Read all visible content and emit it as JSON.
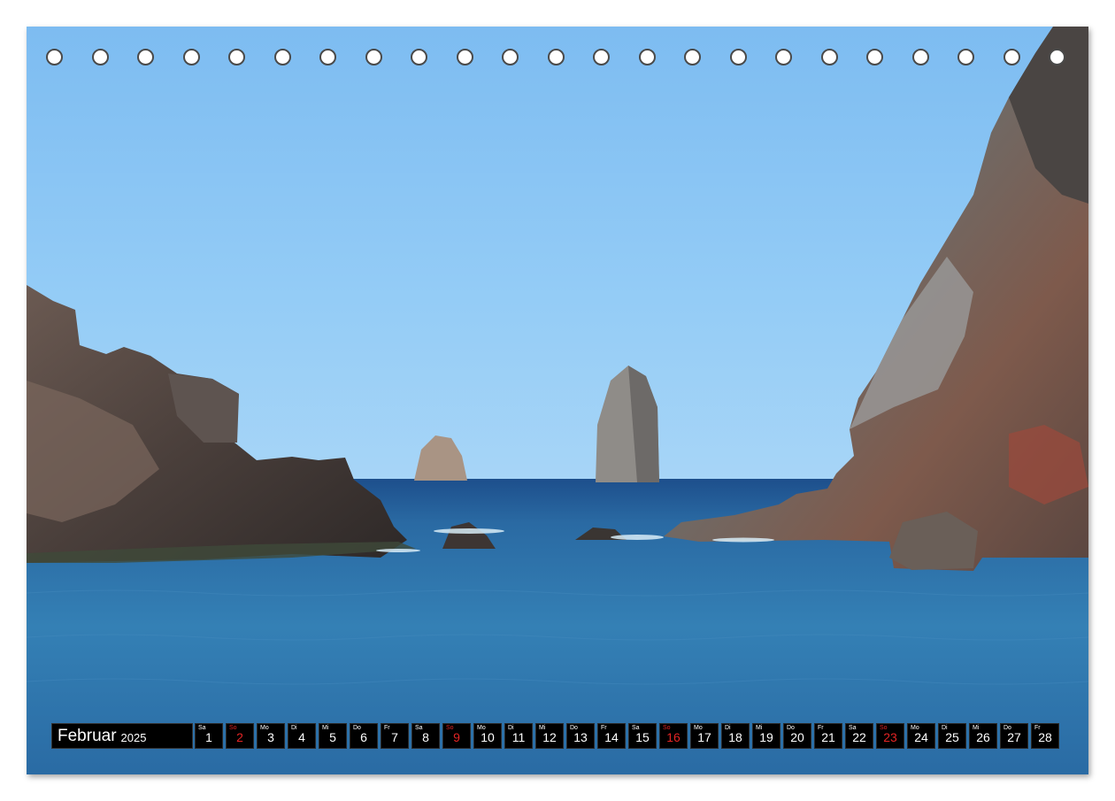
{
  "calendar": {
    "month": "Februar",
    "year": "2025",
    "days": [
      {
        "dow": "Sa",
        "num": "1"
      },
      {
        "dow": "So",
        "num": "2",
        "sunday": true
      },
      {
        "dow": "Mo",
        "num": "3"
      },
      {
        "dow": "Di",
        "num": "4"
      },
      {
        "dow": "Mi",
        "num": "5"
      },
      {
        "dow": "Do",
        "num": "6"
      },
      {
        "dow": "Fr",
        "num": "7"
      },
      {
        "dow": "Sa",
        "num": "8"
      },
      {
        "dow": "So",
        "num": "9",
        "sunday": true
      },
      {
        "dow": "Mo",
        "num": "10"
      },
      {
        "dow": "Di",
        "num": "11"
      },
      {
        "dow": "Mi",
        "num": "12"
      },
      {
        "dow": "Do",
        "num": "13"
      },
      {
        "dow": "Fr",
        "num": "14"
      },
      {
        "dow": "Sa",
        "num": "15"
      },
      {
        "dow": "So",
        "num": "16",
        "sunday": true
      },
      {
        "dow": "Mo",
        "num": "17"
      },
      {
        "dow": "Di",
        "num": "18"
      },
      {
        "dow": "Mi",
        "num": "19"
      },
      {
        "dow": "Do",
        "num": "20"
      },
      {
        "dow": "Fr",
        "num": "21"
      },
      {
        "dow": "Sa",
        "num": "22"
      },
      {
        "dow": "So",
        "num": "23",
        "sunday": true
      },
      {
        "dow": "Mo",
        "num": "24"
      },
      {
        "dow": "Di",
        "num": "25"
      },
      {
        "dow": "Mi",
        "num": "26"
      },
      {
        "dow": "Do",
        "num": "27"
      },
      {
        "dow": "Fr",
        "num": "28"
      }
    ]
  },
  "colors": {
    "sky": "#8cc7f5",
    "sea": "#2f6fa6",
    "bar_bg": "#000000",
    "sunday": "#e32424"
  }
}
